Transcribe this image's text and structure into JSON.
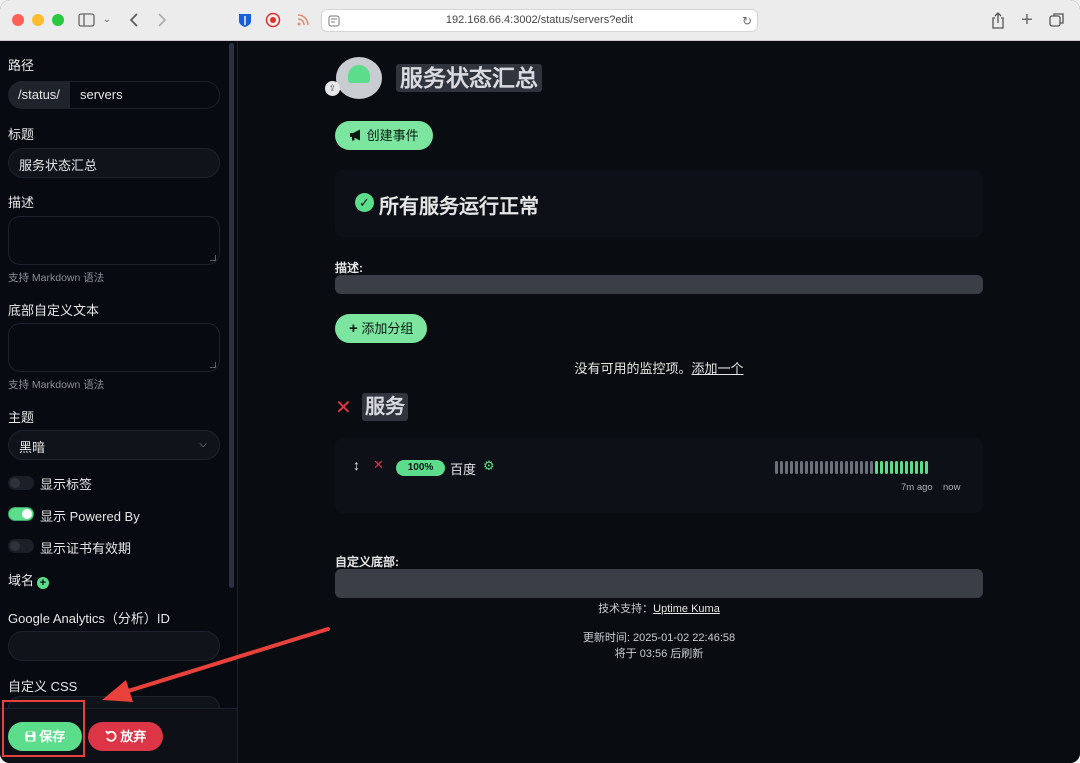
{
  "browser": {
    "url": "192.168.66.4:3002/status/servers?edit"
  },
  "sidebar": {
    "path_label": "路径",
    "path_prefix": "/status/",
    "path_value": "servers",
    "title_label": "标题",
    "title_value": "服务状态汇总",
    "description_label": "描述",
    "description_hint": "支持 Markdown 语法",
    "footer_label": "底部自定义文本",
    "footer_hint": "支持 Markdown 语法",
    "theme_label": "主题",
    "theme_value": "黑暗",
    "toggles": [
      {
        "label": "显示标签",
        "on": false
      },
      {
        "label": "显示 Powered By",
        "on": true
      },
      {
        "label": "显示证书有效期",
        "on": false
      }
    ],
    "domain_label": "域名",
    "ga_label": "Google Analytics（分析）ID",
    "css_label": "自定义 CSS",
    "save_label": "保存",
    "discard_label": "放弃"
  },
  "main": {
    "page_title": "服务状态汇总",
    "create_incident_label": "创建事件",
    "status_message": "所有服务运行正常",
    "description_label": "描述:",
    "add_group_label": "添加分组",
    "empty_message": "没有可用的监控项。",
    "empty_link": "添加一个",
    "group_title": "服务",
    "monitor": {
      "uptime": "100%",
      "name": "百度",
      "beats_down": 20,
      "beats_up": 11,
      "time_start": "7m ago",
      "time_end": "now"
    },
    "custom_footer_label": "自定义底部:",
    "powered_by_prefix": "技术支持：",
    "powered_by_link": "Uptime Kuma",
    "last_updated": "更新时间: 2025-01-02 22:46:58",
    "refresh_in": "将于 03:56 后刷新"
  },
  "colors": {
    "accent": "#5cdd8b",
    "danger": "#dc3545",
    "beat_gray": "#6b7079",
    "annotation": "#e8403a"
  }
}
